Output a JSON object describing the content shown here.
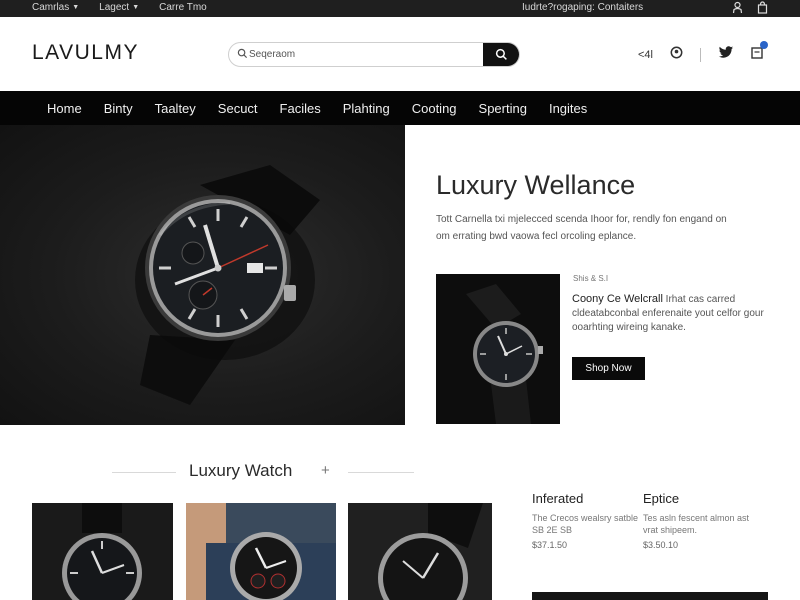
{
  "topbar": {
    "links": [
      {
        "label": "Camrlas"
      },
      {
        "label": "Lagect"
      },
      {
        "label": "Carre Tmo"
      }
    ],
    "promo": "Iudrte?rogaping: Contaiters"
  },
  "header": {
    "logo": "LAVULMY",
    "search_placeholder": "Seqeraom",
    "lang": "<4l"
  },
  "nav": {
    "items": [
      "Home",
      "Binty",
      "Taaltey",
      "Secuct",
      "Faciles",
      "Plahting",
      "Cooting",
      "Sperting",
      "Ingites"
    ]
  },
  "hero": {
    "title": "Luxury Wellance",
    "description": "Tott Carnella txi mjelecced scenda Ihoor for, rendly fon engand on om errating bwd vaowa fecl orcoling eplance."
  },
  "promo": {
    "tag": "Shis & S.I",
    "title": "Coony Ce Welcrall",
    "text": "Irhat cas carred cldeatabconbal enferenaite yout celfor gour ooarhting wireing kanake.",
    "button": "Shop Now"
  },
  "section": {
    "title": "Luxury Watch",
    "plus": "+"
  },
  "columns": [
    {
      "title": "Inferated",
      "desc": "The Crecos wealsry satble SB 2E SB",
      "price": "$37.1.50"
    },
    {
      "title": "Eptice",
      "desc": "Tes asln fescent almon ast vrat shipeem.",
      "price": "$3.50.10"
    }
  ],
  "colors": {
    "nav_bg": "#050505",
    "topbar_bg": "#1f1f1f",
    "accent": "#2a64c8"
  }
}
